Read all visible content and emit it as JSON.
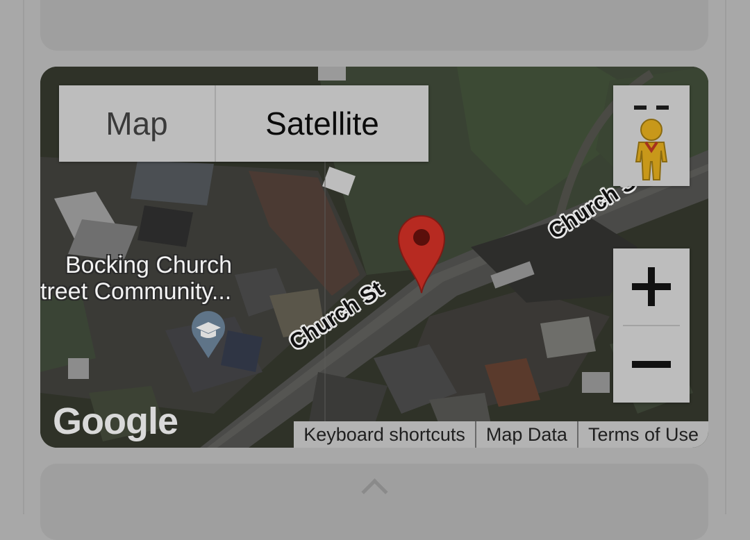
{
  "map_type": {
    "map_label": "Map",
    "satellite_label": "Satellite",
    "selected": "Satellite"
  },
  "poi": {
    "line1": "Bocking Church",
    "line2": "treet Community..."
  },
  "roads": {
    "lower": "Church St",
    "upper": "Church S"
  },
  "logo": "Google",
  "footer": {
    "keyboard_shortcuts": "Keyboard shortcuts",
    "map_data": "Map Data",
    "terms": "Terms of Use"
  },
  "colors": {
    "marker": "#b72a21",
    "overlay_gray": "#a8a8a8",
    "control_bg": "#bdbdbd",
    "pegman": "#c8981a"
  },
  "icons": [
    "pegman-icon",
    "zoom-in-icon",
    "zoom-out-icon",
    "map-marker-icon",
    "school-icon",
    "chevron-up-icon"
  ]
}
